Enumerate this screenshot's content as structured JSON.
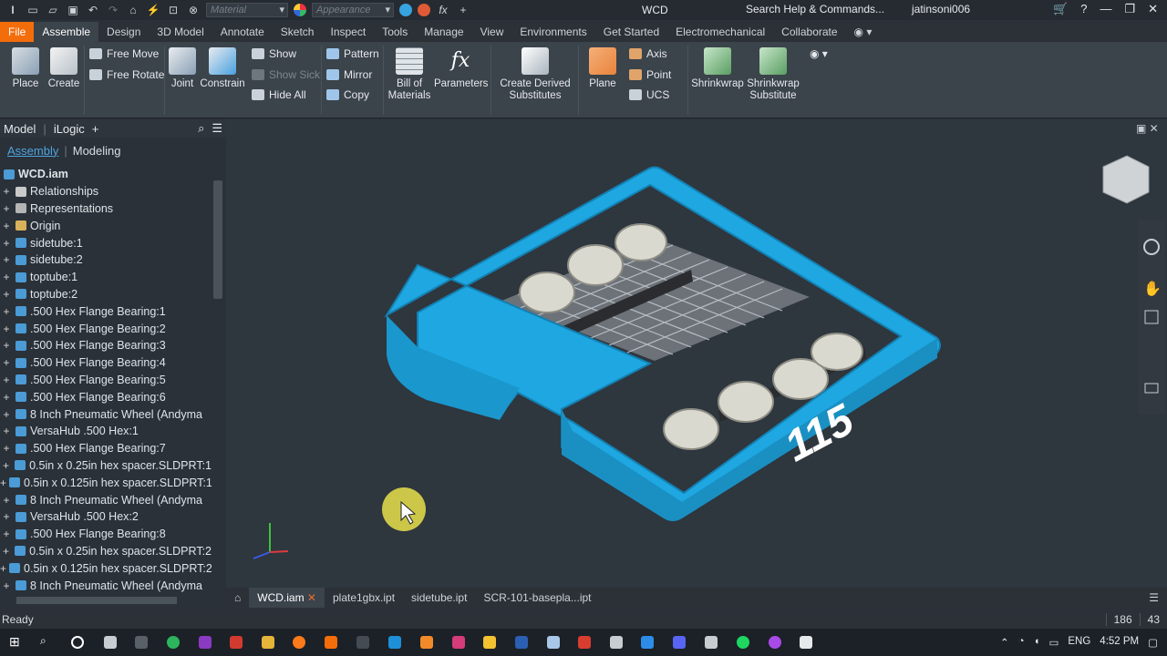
{
  "window": {
    "title": "WCD",
    "search_help": "Search Help & Commands...",
    "user": "jatinsoni006"
  },
  "qat": {
    "material_placeholder": "Material",
    "appearance_placeholder": "Appearance"
  },
  "tabs": [
    "File",
    "Assemble",
    "Design",
    "3D Model",
    "Annotate",
    "Sketch",
    "Inspect",
    "Tools",
    "Manage",
    "View",
    "Environments",
    "Get Started",
    "Electromechanical",
    "Collaborate"
  ],
  "ribbon": {
    "place": "Place",
    "create": "Create",
    "free_move": "Free Move",
    "free_rotate": "Free Rotate",
    "joint": "Joint",
    "constrain": "Constrain",
    "show": "Show",
    "show_sick": "Show Sick",
    "hide_all": "Hide All",
    "pattern": "Pattern",
    "mirror": "Mirror",
    "copy": "Copy",
    "bom_line1": "Bill of",
    "bom_line2": "Materials",
    "parameters": "Parameters",
    "derived_line1": "Create Derived",
    "derived_line2": "Substitutes",
    "plane": "Plane",
    "axis": "Axis",
    "point": "Point",
    "ucs": "UCS",
    "shrinkwrap": "Shrinkwrap",
    "shrinkwrap_sub_line1": "Shrinkwrap",
    "shrinkwrap_sub_line2": "Substitute"
  },
  "browser": {
    "tab_model": "Model",
    "tab_ilogic": "iLogic",
    "sub_assembly": "Assembly",
    "sub_modeling": "Modeling",
    "root": "WCD.iam",
    "nodes": [
      {
        "label": "Relationships",
        "icon": "rel"
      },
      {
        "label": "Representations",
        "icon": "rep"
      },
      {
        "label": "Origin",
        "icon": "folder"
      },
      {
        "label": "sidetube:1",
        "icon": "part"
      },
      {
        "label": "sidetube:2",
        "icon": "part"
      },
      {
        "label": "toptube:1",
        "icon": "part"
      },
      {
        "label": "toptube:2",
        "icon": "part"
      },
      {
        "label": ".500 Hex Flange Bearing:1",
        "icon": "part"
      },
      {
        "label": ".500 Hex Flange Bearing:2",
        "icon": "part"
      },
      {
        "label": ".500 Hex Flange Bearing:3",
        "icon": "part"
      },
      {
        "label": ".500 Hex Flange Bearing:4",
        "icon": "part"
      },
      {
        "label": ".500 Hex Flange Bearing:5",
        "icon": "part"
      },
      {
        "label": ".500 Hex Flange Bearing:6",
        "icon": "part"
      },
      {
        "label": "8 Inch Pneumatic Wheel (Andyma",
        "icon": "asm"
      },
      {
        "label": "VersaHub .500 Hex:1",
        "icon": "part"
      },
      {
        "label": ".500 Hex Flange Bearing:7",
        "icon": "part"
      },
      {
        "label": "0.5in x 0.25in hex spacer.SLDPRT:1",
        "icon": "part"
      },
      {
        "label": "0.5in x 0.125in hex spacer.SLDPRT:1",
        "icon": "part"
      },
      {
        "label": "8 Inch Pneumatic Wheel (Andyma",
        "icon": "asm"
      },
      {
        "label": "VersaHub .500 Hex:2",
        "icon": "part"
      },
      {
        "label": ".500 Hex Flange Bearing:8",
        "icon": "part"
      },
      {
        "label": "0.5in x 0.25in hex spacer.SLDPRT:2",
        "icon": "part"
      },
      {
        "label": "0.5in x 0.125in hex spacer.SLDPRT:2",
        "icon": "part"
      },
      {
        "label": "8 Inch Pneumatic Wheel (Andyma",
        "icon": "asm"
      }
    ]
  },
  "viewport": {
    "number_label": "115",
    "bumper_color": "#1ea7e1"
  },
  "doc_tabs": [
    "WCD.iam",
    "plate1gbx.ipt",
    "sidetube.ipt",
    "SCR-101-basepla...ipt"
  ],
  "status": {
    "text": "Ready",
    "count1": "186",
    "count2": "43"
  },
  "tray": {
    "lang": "ENG",
    "time": "4:52 PM"
  }
}
